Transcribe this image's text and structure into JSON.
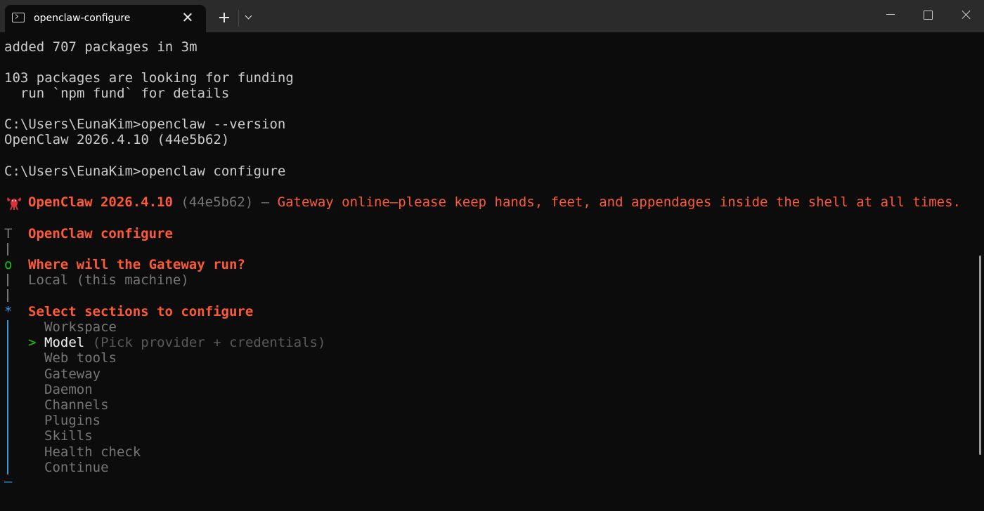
{
  "window": {
    "tab_title": "openclaw-configure"
  },
  "terminal": {
    "lines": [
      "added 707 packages in 3m",
      "103 packages are looking for funding",
      "  run `npm fund` for details",
      "C:\\Users\\EunaKim>openclaw --version",
      "OpenClaw 2026.4.10 (44e5b62)",
      "C:\\Users\\EunaKim>openclaw configure"
    ],
    "banner": {
      "name": "OpenClaw 2026.4.10",
      "hash": "(44e5b62)",
      "dash": "—",
      "tagline": "Gateway online—please keep hands, feet, and appendages inside the shell at all times."
    },
    "wizard": {
      "title": "OpenClaw configure",
      "q1": "Where will the Gateway run?",
      "a1": "Local (this machine)",
      "q2": "Select sections to configure",
      "selected_hint": "(Pick provider + credentials)",
      "options": [
        "Workspace",
        "Model",
        "Web tools",
        "Gateway",
        "Daemon",
        "Channels",
        "Plugins",
        "Skills",
        "Health check",
        "Continue"
      ],
      "selected_index": 1
    },
    "symbols": {
      "start": "T",
      "done": "o",
      "active": "*",
      "pointer": ">",
      "end": "—"
    },
    "colors": {
      "accent": "#ff5a36",
      "done": "#16c60c",
      "active": "#3a96dd"
    }
  }
}
